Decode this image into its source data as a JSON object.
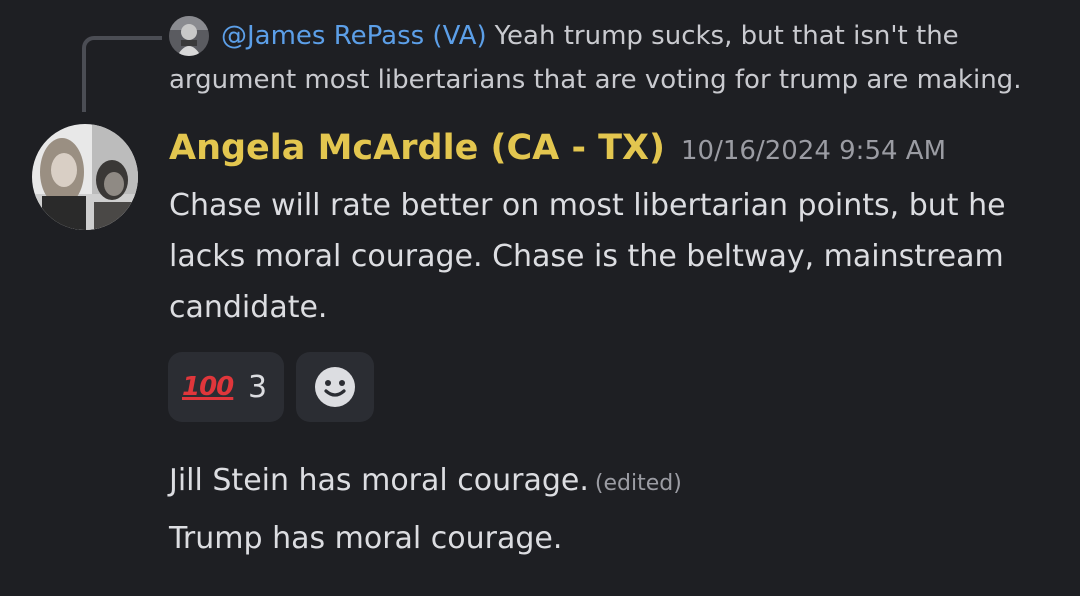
{
  "reply": {
    "author": "@James RePass (VA)",
    "text": "Yeah trump sucks, but that isn't the argument most libertarians that are voting for trump are making."
  },
  "message": {
    "author": "Angela McArdle (CA - TX)",
    "timestamp": "10/16/2024 9:54 AM",
    "text": "Chase will rate better on most libertarian points, but he lacks moral courage. Chase is the beltway, mainstream candidate."
  },
  "reactions": [
    {
      "emoji": "100",
      "icon": "hundred-points-emoji",
      "count": "3"
    }
  ],
  "add_reaction_icon": "smiley-add-reaction-icon",
  "followups": [
    {
      "text": "Jill Stein has moral courage.",
      "edited_label": "(edited)"
    },
    {
      "text": "Trump has moral courage."
    }
  ],
  "colors": {
    "background": "#1e1f23",
    "author": "#e3c64f",
    "mention": "#5c9fe8",
    "reaction_bg": "#2b2d33"
  }
}
